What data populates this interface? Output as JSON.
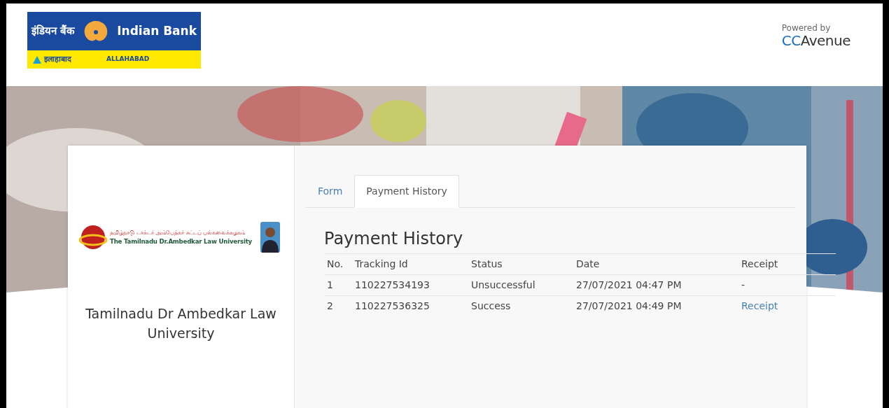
{
  "header": {
    "bank_logo": {
      "hindi_name": "इंडियन बैंक",
      "english_name": "Indian Bank",
      "hindi_sub": "इलाहाबाद",
      "english_sub": "ALLAHABAD"
    },
    "powered_by": {
      "label": "Powered by",
      "brand_prefix": "CC",
      "brand_suffix": "Avenue"
    }
  },
  "sidebar": {
    "logo_tamil": "தமிழ்நாடு டாக்டர் அம்பேத்கர் சட்டப் பல்கலைக்கழகம்",
    "logo_english": "The Tamilnadu Dr.Ambedkar Law University",
    "title": "Tamilnadu Dr Ambedkar Law University"
  },
  "tabs": [
    {
      "label": "Form",
      "selected": false
    },
    {
      "label": "Payment History",
      "selected": true
    }
  ],
  "history": {
    "heading": "Payment History",
    "columns": [
      "No.",
      "Tracking Id",
      "Status",
      "Date",
      "Receipt"
    ],
    "rows": [
      {
        "no": "1",
        "tracking_id": "110227534193",
        "status": "Unsuccessful",
        "date": "27/07/2021 04:47 PM",
        "receipt": "-",
        "kind": "text"
      },
      {
        "no": "2",
        "tracking_id": "110227536325",
        "status": "Success",
        "date": "27/07/2021 04:49 PM",
        "receipt": "Receipt",
        "kind": "link"
      }
    ]
  }
}
